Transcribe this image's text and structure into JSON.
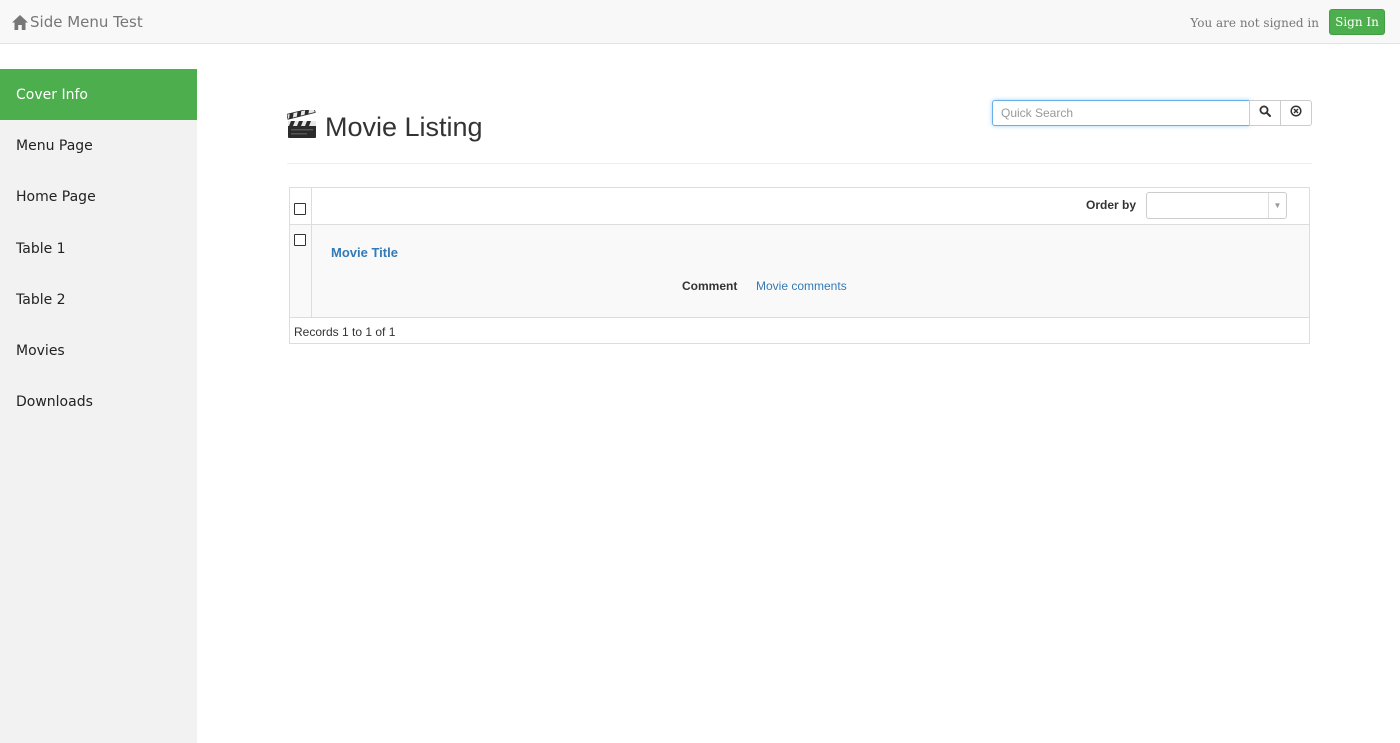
{
  "navbar": {
    "brand_icon": "home-icon",
    "brand_label": "Side Menu Test",
    "signed_status": "You are not signed in",
    "signin_label": "Sign In",
    "accent_color": "#4cae4c"
  },
  "sidebar": {
    "items": [
      {
        "label": "Cover Info",
        "active": true
      },
      {
        "label": "Menu Page",
        "active": false
      },
      {
        "label": "Home Page",
        "active": false
      },
      {
        "label": "Table 1",
        "active": false
      },
      {
        "label": "Table 2",
        "active": false
      },
      {
        "label": "Movies",
        "active": false
      },
      {
        "label": "Downloads",
        "active": false
      }
    ]
  },
  "page": {
    "title_icon": "clapperboard-icon",
    "title": "Movie Listing"
  },
  "search": {
    "placeholder": "Quick Search",
    "value": "",
    "search_icon": "search-icon",
    "clear_icon": "clear-circle-icon"
  },
  "grid": {
    "order_label": "Order by",
    "order_value": "",
    "rows": [
      {
        "title": "Movie Title",
        "comment_label": "Comment",
        "comment_value": "Movie comments"
      }
    ],
    "footer": "Records 1 to 1 of 1"
  }
}
